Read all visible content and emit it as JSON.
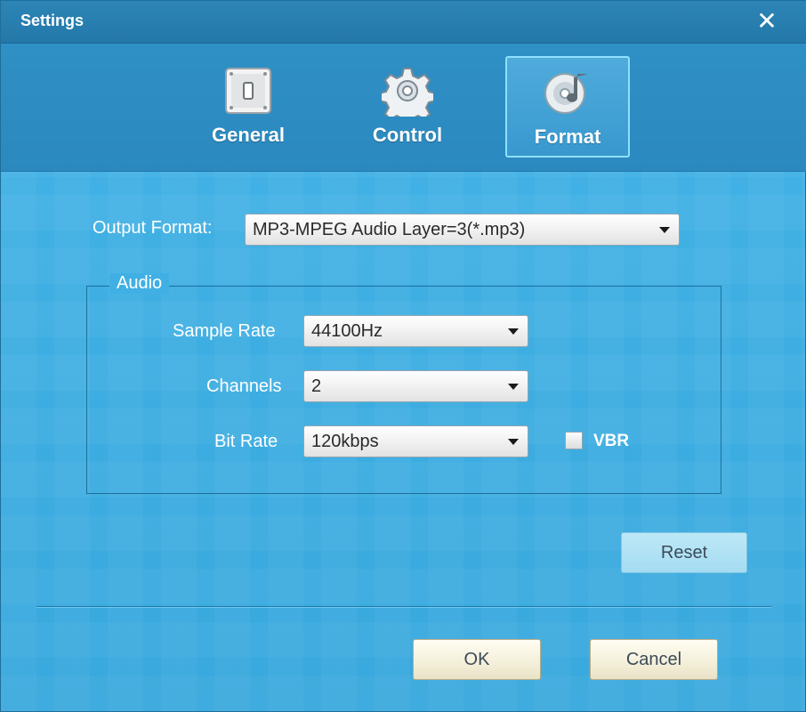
{
  "window": {
    "title": "Settings"
  },
  "tabs": [
    {
      "label": "General",
      "icon": "switch-icon",
      "active": false
    },
    {
      "label": "Control",
      "icon": "gear-icon",
      "active": false
    },
    {
      "label": "Format",
      "icon": "disc-music-icon",
      "active": true
    }
  ],
  "format": {
    "output_format_label": "Output Format:",
    "output_format_value": "MP3-MPEG Audio Layer=3(*.mp3)"
  },
  "audio": {
    "group_title": "Audio",
    "sample_rate_label": "Sample Rate",
    "sample_rate_value": "44100Hz",
    "channels_label": "Channels",
    "channels_value": "2",
    "bit_rate_label": "Bit Rate",
    "bit_rate_value": "120kbps",
    "vbr_label": "VBR",
    "vbr_checked": false
  },
  "buttons": {
    "reset": "Reset",
    "ok": "OK",
    "cancel": "Cancel"
  },
  "colors": {
    "background": "#3eaee2",
    "titlebar": "#2378a9",
    "tab_active_border": "#8ee0ff"
  }
}
